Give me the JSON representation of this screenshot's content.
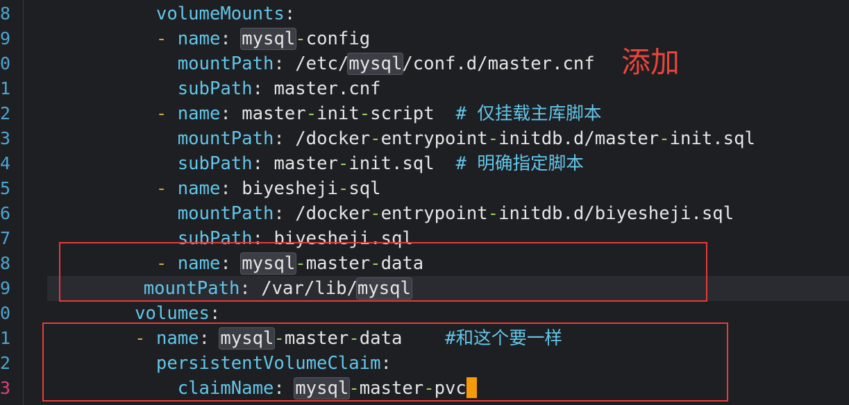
{
  "gutter": {
    "numbers": [
      "8",
      "9",
      "0",
      "1",
      "2",
      "3",
      "4",
      "5",
      "6",
      "7",
      "8",
      "9",
      "0",
      "1",
      "2",
      "3"
    ],
    "active_index": 15
  },
  "code": {
    "l0_key": "volumeMounts",
    "l1_key": "name",
    "l1_hl": "mysql",
    "l1_rest": "config",
    "l2_key": "mountPath",
    "l2_a": "/etc/",
    "l2_hl": "mysql",
    "l2_b": "/conf.d/master.cnf",
    "l3_key": "subPath",
    "l3_val": "master.cnf",
    "l4_key": "name",
    "l4_a": "master",
    "l4_b": "init",
    "l4_c": "script",
    "l4_comment": "# 仅挂载主库脚本",
    "l5_key": "mountPath",
    "l5_a": "/docker",
    "l5_b": "entrypoint",
    "l5_c": "initdb.d/master",
    "l5_d": "init.sql",
    "l6_key": "subPath",
    "l6_a": "master",
    "l6_b": "init.sql",
    "l6_comment": "# 明确指定脚本",
    "l7_key": "name",
    "l7_a": "biyesheji",
    "l7_b": "sql",
    "l8_key": "mountPath",
    "l8_a": "/docker",
    "l8_b": "entrypoint",
    "l8_c": "initdb.d/biyesheji.sql",
    "l9_key": "subPath",
    "l9_a": "biyesheji.sql",
    "l10_key": "name",
    "l10_hl": "mysql",
    "l10_b": "master",
    "l10_c": "data",
    "l11_key": "mountPath",
    "l11_a": "/var/lib/",
    "l11_hl": "mysql",
    "l12_key": "volumes",
    "l13_key": "name",
    "l13_hl": "mysql",
    "l13_b": "master",
    "l13_c": "data",
    "l13_comment": "#和这个要一样",
    "l14_key": "persistentVolumeClaim",
    "l15_key": "claimName",
    "l15_hl": "mysql",
    "l15_b": "master",
    "l15_c": "pvc"
  },
  "annotation": "添加",
  "colors": {
    "background": "#1e1f22",
    "key": "#63c6e9",
    "dash": "#d1a94a",
    "cursor": "#f59b0a",
    "redbox": "#e83b3b",
    "annotation": "#e8453c"
  }
}
